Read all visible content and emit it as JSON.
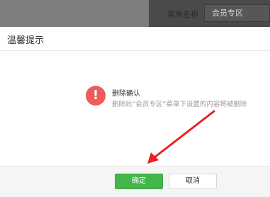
{
  "background": {
    "field_label": "菜单名称",
    "field_value": "会员专区"
  },
  "dialog": {
    "title": "温馨提示",
    "icon": "exclamation-icon",
    "message_title": "删除确认",
    "message_desc": "删除后“会员专区”菜单下设置的内容将被删除",
    "confirm_label": "确定",
    "cancel_label": "取消"
  },
  "colors": {
    "confirm_green": "#44b549",
    "warning_red": "#ef5a5a",
    "annotation_arrow": "#e8231f"
  }
}
